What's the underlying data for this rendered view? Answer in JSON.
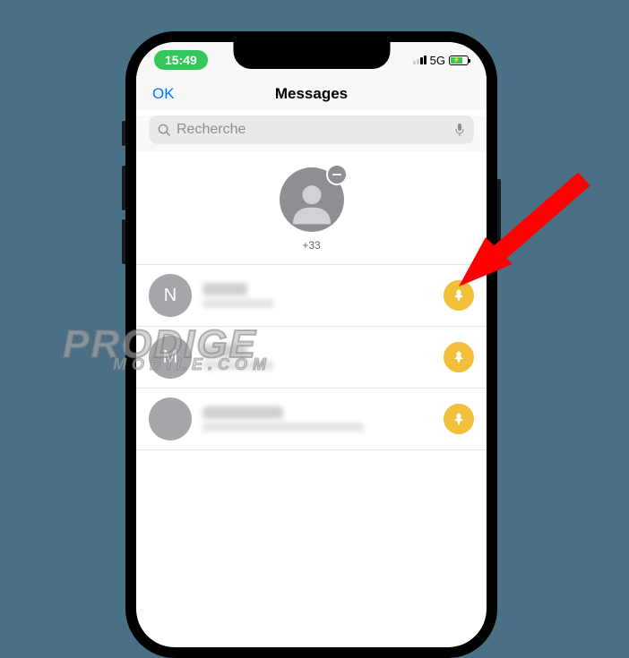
{
  "status": {
    "time": "15:49",
    "network": "5G"
  },
  "header": {
    "left_action": "OK",
    "title": "Messages"
  },
  "search": {
    "placeholder": "Recherche"
  },
  "pinned": {
    "label": "+33"
  },
  "conversations": [
    {
      "initial": "N"
    },
    {
      "initial": "M"
    },
    {
      "initial": ""
    }
  ],
  "watermark": {
    "line1": "PRODIGE",
    "line2": "MOBILE.COM"
  }
}
